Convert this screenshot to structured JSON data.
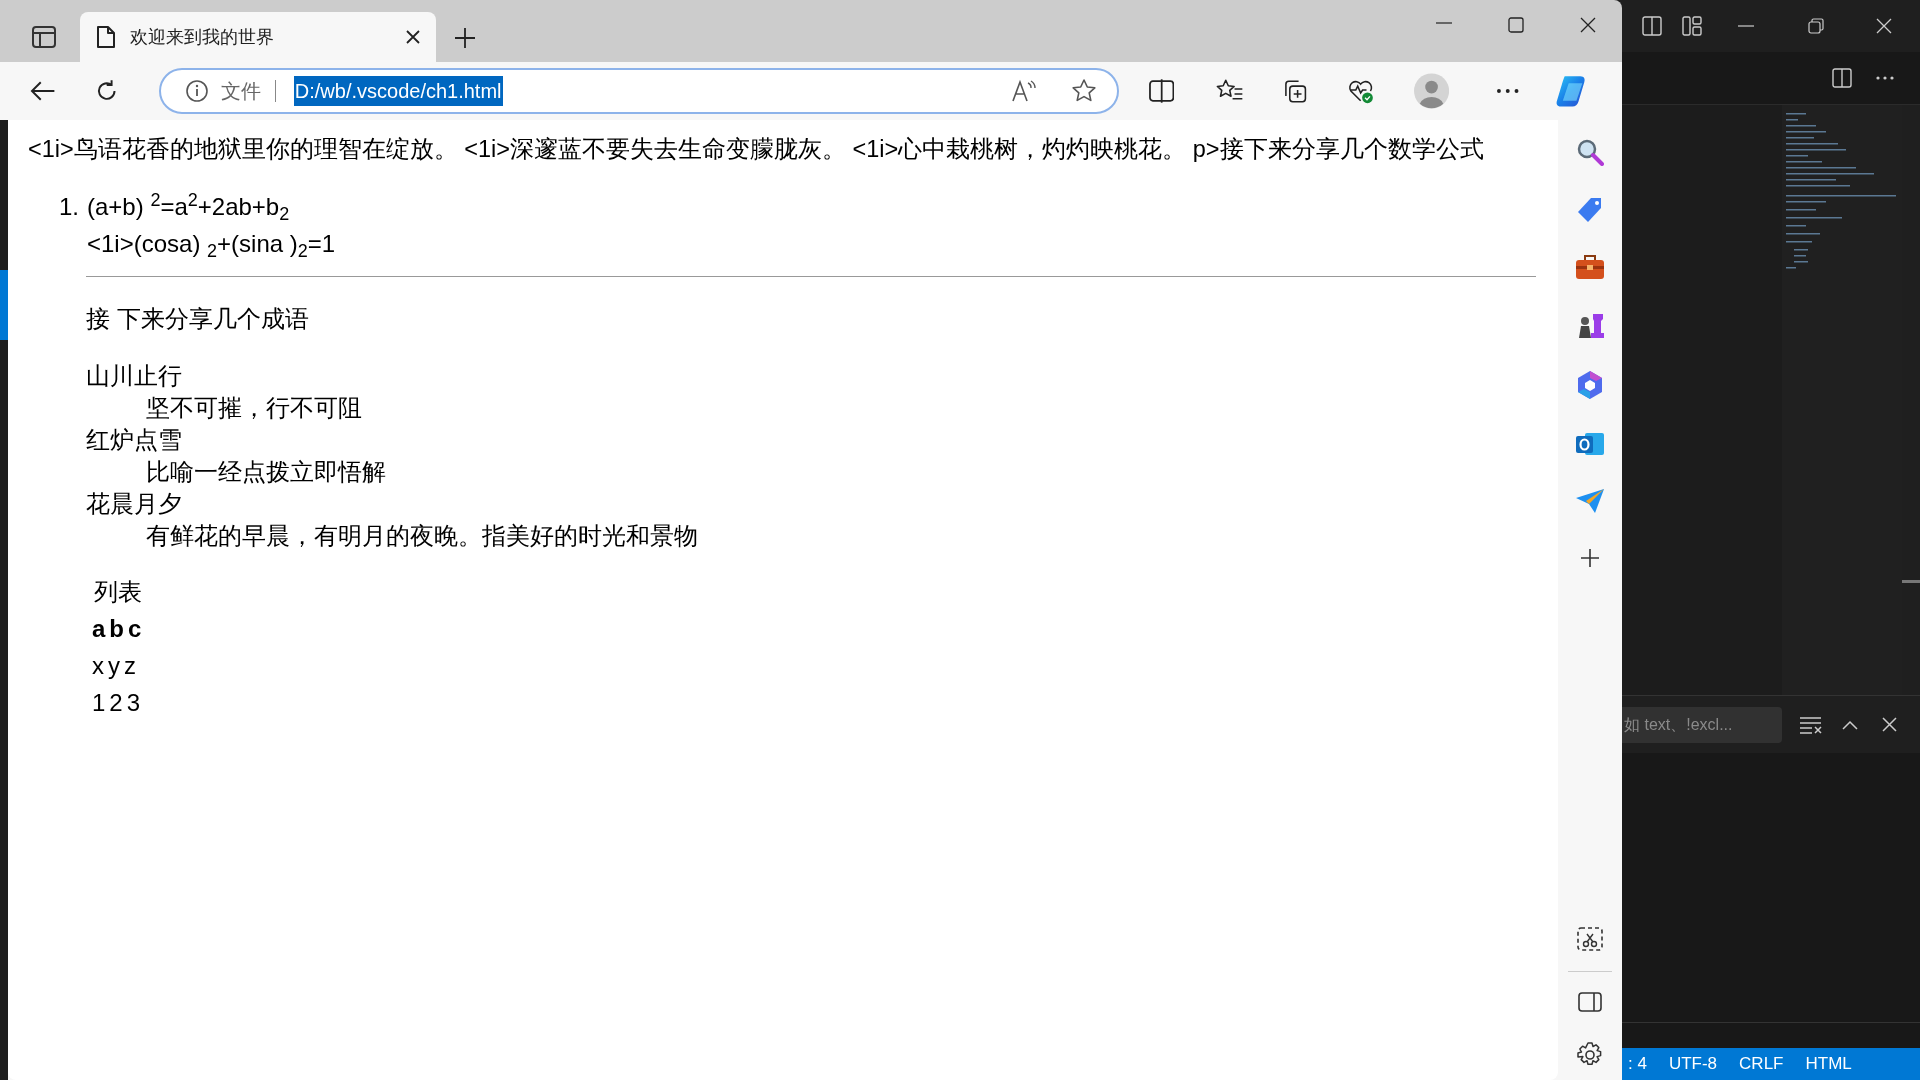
{
  "browser": {
    "tab": {
      "title": "欢迎来到我的世界"
    },
    "address": {
      "scheme_label": "文件",
      "url": "D:/wb/.vscode/ch1.html",
      "url_selected": true
    }
  },
  "page": {
    "intro": "<1i>鸟语花香的地狱里你的理智在绽放。 <1i>深邃蓝不要失去生命变朦胧灰。 <1i>心中栽桃树，灼灼映桃花。 p>接下来分享几个数学公式",
    "formulas": [
      {
        "number": "1.",
        "lines": [
          "(a+b) $^{2}$=a$^{2}$+2ab+b$_{2}$",
          "<1i>(cosa) $_{2}$+(sina )$_{2}$=1"
        ]
      }
    ],
    "idioms_heading": "接 下来分享几个成语",
    "idioms": [
      {
        "term": "山川止行",
        "meaning": "坚不可摧，行不可阻"
      },
      {
        "term": "红炉点雪",
        "meaning": "比喻一经点拨立即悟解"
      },
      {
        "term": "花晨月夕",
        "meaning": "有鲜花的早晨，有明月的夜晚。指美好的时光和景物"
      }
    ],
    "table": {
      "caption": "列表",
      "header": [
        "a",
        "b",
        "c"
      ],
      "rows": [
        [
          "x",
          "y",
          "z"
        ],
        [
          "1",
          "2",
          "3"
        ]
      ]
    }
  },
  "editor": {
    "search_placeholder": "如 text、!excl...",
    "status_bar": [
      ": 4",
      "UTF-8",
      "CRLF",
      "HTML"
    ]
  }
}
